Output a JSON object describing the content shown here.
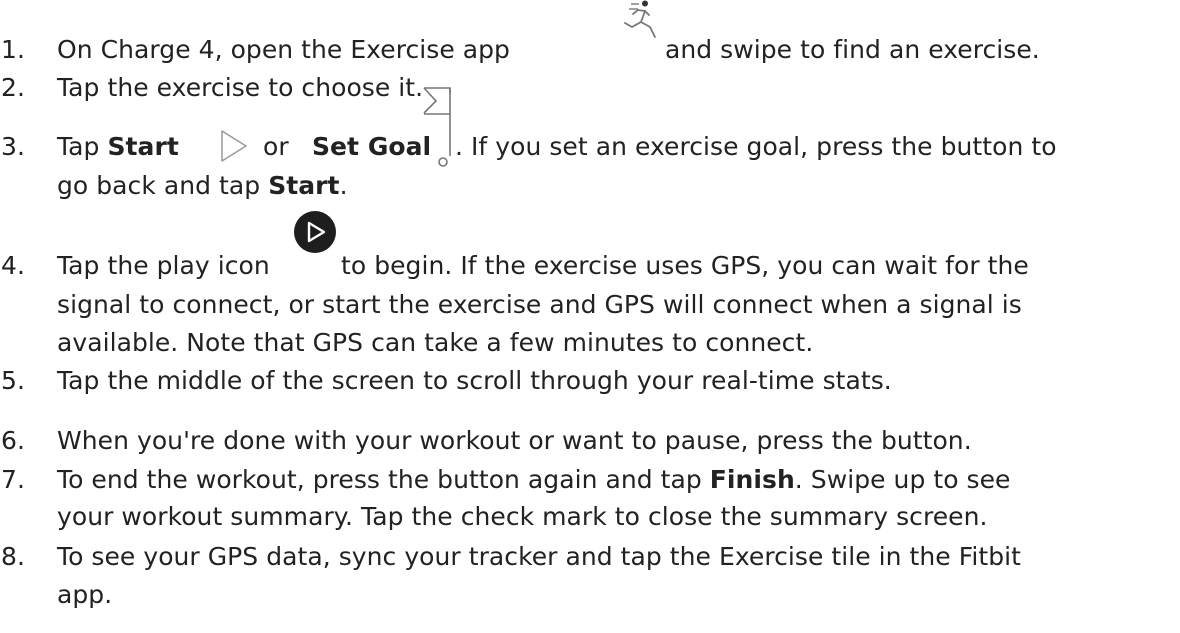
{
  "steps": [
    {
      "number": "1.",
      "lines": [
        {
          "text": "On Charge 4, open the Exercise app"
        },
        {
          "text": "and swipe to find an exercise."
        }
      ]
    },
    {
      "number": "2.",
      "text": "Tap the exercise to choose it."
    },
    {
      "number": "3.",
      "a": "Tap ",
      "b": "Start",
      "c": "or",
      "d": "Set Goal",
      "e": ". If you set an exercise goal, press the button to",
      "f": "go back and tap ",
      "g": "Start",
      "h": "."
    },
    {
      "number": "4.",
      "a": "Tap the play icon",
      "b": "to begin. If the exercise uses GPS, you can wait for the",
      "c": "signal to connect, or start the exercise and GPS will connect when a signal is",
      "d": "available. Note that GPS can take a few minutes to connect."
    },
    {
      "number": "5.",
      "text": "Tap the middle of the screen to scroll through your real-time stats."
    },
    {
      "number": "6.",
      "text": "When you're done with your workout or want to pause, press the button."
    },
    {
      "number": "7.",
      "a": "To end the workout, press the button again and tap ",
      "b": "Finish",
      "c": ". Swipe up to see",
      "d": "your workout summary. Tap the check mark to close the summary screen."
    },
    {
      "number": "8.",
      "a": "To see your GPS data, sync your tracker and tap the Exercise tile in the Fitbit",
      "b": "app."
    }
  ],
  "icons": {
    "exercise": "running-figure-icon",
    "start": "play-outline-icon",
    "goal": "flag-goal-icon",
    "play": "play-circle-icon"
  }
}
